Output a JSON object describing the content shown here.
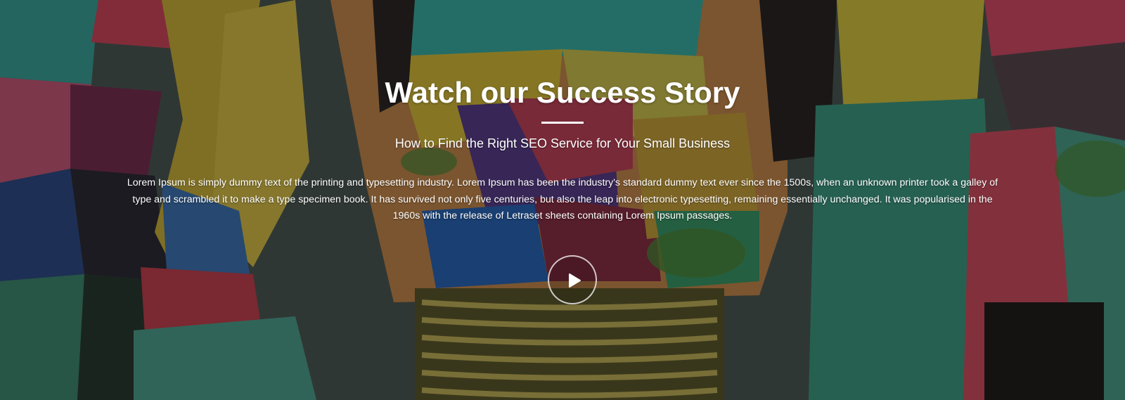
{
  "hero": {
    "title": "Watch our Success Story",
    "subtitle": "How to Find the Right SEO Service for Your Small Business",
    "paragraph": "Lorem Ipsum is simply dummy text of the printing and typesetting industry. Lorem Ipsum has been the industry's standard dummy text ever since the 1500s, when an unknown printer took a galley of type and scrambled it to make a type specimen book. It has survived not only five centuries, but also the leap into electronic typesetting, remaining essentially unchanged. It was popularised in the 1960s with the release of Letraset sheets containing Lorem Ipsum passages.",
    "play_icon": "play-icon",
    "background": "mural-wall-photo"
  },
  "colors": {
    "text": "#ffffff",
    "overlay": "#000000"
  }
}
